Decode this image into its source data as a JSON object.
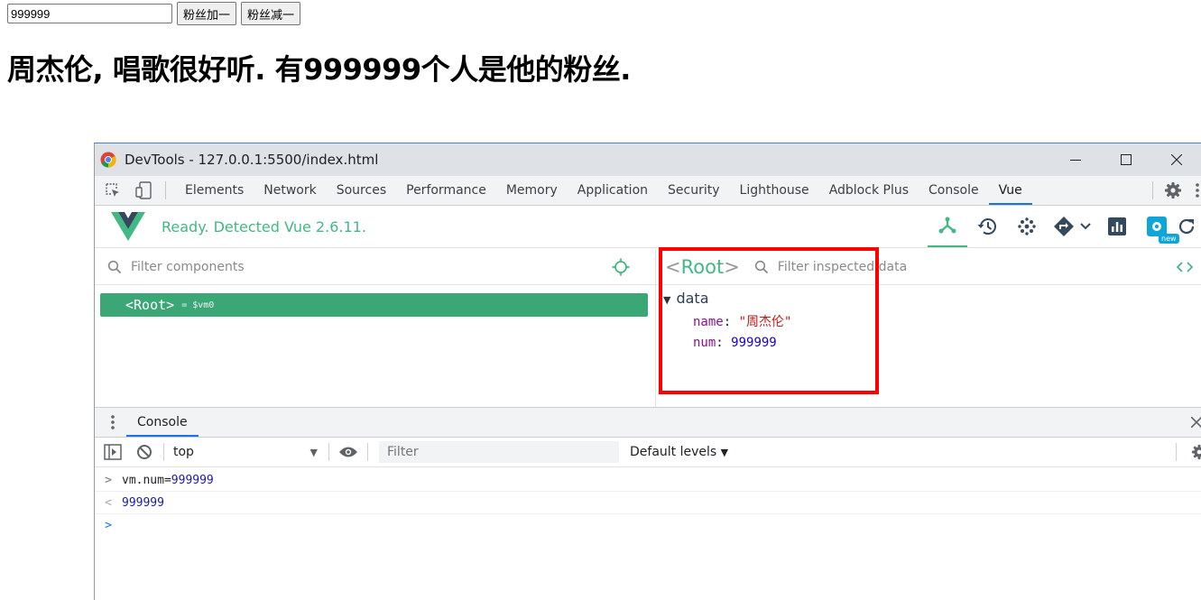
{
  "page": {
    "input_value": "999999",
    "add_button": "粉丝加一",
    "minus_button": "粉丝减一",
    "headline": "周杰伦, 唱歌很好听. 有999999个人是他的粉丝."
  },
  "devtools": {
    "window_title": "DevTools - 127.0.0.1:5500/index.html",
    "tabs": [
      "Elements",
      "Network",
      "Sources",
      "Performance",
      "Memory",
      "Application",
      "Security",
      "Lighthouse",
      "Adblock Plus",
      "Console",
      "Vue"
    ],
    "active_tab": "Vue",
    "vue_status": "Ready. Detected Vue 2.6.11.",
    "new_badge": "new",
    "components": {
      "filter_placeholder": "Filter components",
      "root_label": "<Root>",
      "vm_ref": "= $vm0"
    },
    "inspector": {
      "title": "Root",
      "filter_placeholder": "Filter inspected data",
      "section": "data",
      "props": [
        {
          "key": "name",
          "value": "\"周杰伦\""
        },
        {
          "key": "num",
          "value": "999999"
        }
      ]
    },
    "console": {
      "tab_label": "Console",
      "context": "top",
      "filter_placeholder": "Filter",
      "levels": "Default levels",
      "input_command": "vm.num=",
      "input_value": "999999",
      "result": "999999"
    }
  },
  "colors": {
    "vue_green": "#42b983",
    "root_row": "#3ba776",
    "highlight": "#ff0000",
    "active_tab_underline": "#1a73e8"
  }
}
